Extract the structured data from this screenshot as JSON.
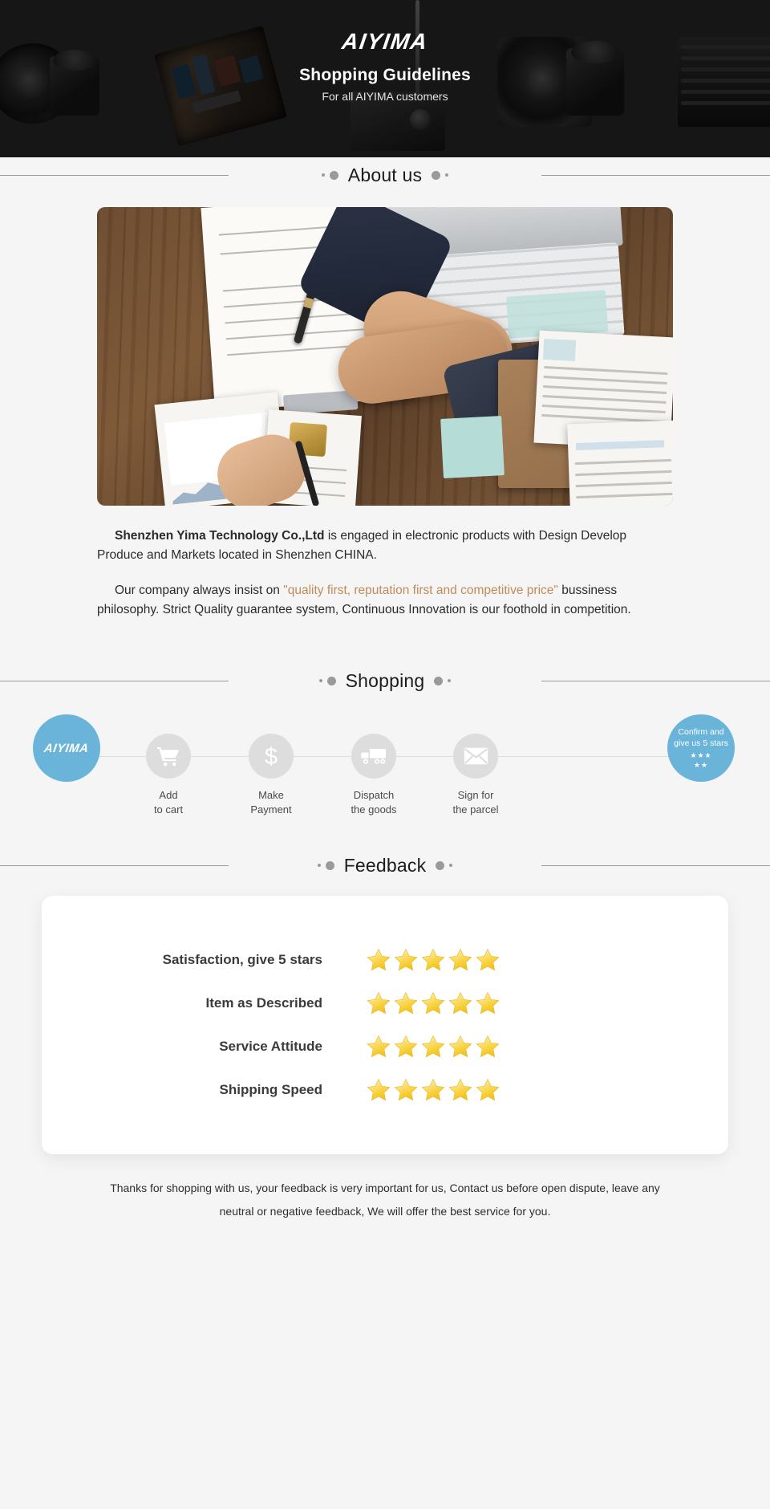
{
  "hero": {
    "brand": "AIYIMA",
    "title": "Shopping Guidelines",
    "subtitle": "For all AIYIMA customers"
  },
  "sections": {
    "about_title": "About us",
    "shopping_title": "Shopping",
    "feedback_title": "Feedback"
  },
  "about": {
    "paragraph1_bold": "Shenzhen Yima Technology Co.,Ltd",
    "paragraph1_rest": " is engaged in electronic products with Design Develop Produce and Markets located in Shenzhen CHINA.",
    "paragraph2_pre": "Our company always insist on ",
    "paragraph2_quote": "\"quality first, reputation first and competitive price\"",
    "paragraph2_post": " bussiness philosophy. Strict Quality guarantee system, Continuous Innovation is our foothold in competition.",
    "image_alt": "Business handshake over wooden desk with contract, laptop and reports"
  },
  "shopping": {
    "steps": [
      {
        "icon": "aiyima-logo-icon",
        "label": "",
        "brand_text": "AIYIMA",
        "kind": "brand"
      },
      {
        "icon": "shopping-cart-icon",
        "label": "Add\nto cart",
        "kind": "normal"
      },
      {
        "icon": "dollar-sign-icon",
        "label": "Make\nPayment",
        "kind": "normal"
      },
      {
        "icon": "delivery-truck-icon",
        "label": "Dispatch\nthe goods",
        "kind": "normal"
      },
      {
        "icon": "envelope-icon",
        "label": "Sign for\nthe parcel",
        "kind": "normal"
      },
      {
        "icon": "five-stars-icon",
        "label": "",
        "confirm_text": "Confirm and\ngive us 5 stars",
        "stars_top": "★★★",
        "stars_bottom": "★★",
        "kind": "last"
      }
    ]
  },
  "feedback": {
    "rows": [
      {
        "label": "Satisfaction, give 5 stars",
        "stars": 5
      },
      {
        "label": "Item as Described",
        "stars": 5
      },
      {
        "label": "Service Attitude",
        "stars": 5
      },
      {
        "label": "Shipping Speed",
        "stars": 5
      }
    ]
  },
  "footer": {
    "note": "Thanks for shopping with us, your feedback is very important for us, Contact us before open dispute, leave any neutral or negative feedback, We will offer the best service for you."
  },
  "colors": {
    "accent_blue": "#6ab4da",
    "quote_brown": "#c08a5a",
    "page_bg": "#f5f5f6",
    "hero_bg": "#161616",
    "star_gold": "#f7d44c"
  }
}
